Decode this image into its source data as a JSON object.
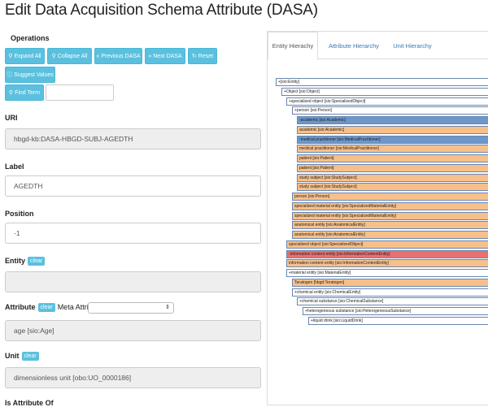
{
  "page": {
    "title": "Edit Data Acquisition Schema Attribute (DASA)"
  },
  "operations": {
    "label": "Operations",
    "buttons": {
      "expand_all": "Expand All",
      "collapse_all": "Collapse All",
      "previous_dasa": "Previous DASA",
      "next_dasa": "Next DASA",
      "reset": "Reset",
      "suggest_values": "Suggest Values",
      "find_term": "Find Term"
    },
    "find_term_value": ""
  },
  "fields": {
    "uri": {
      "label": "URI",
      "value": "hbgd-kb:DASA-HBGD-SUBJ-AGEDTH"
    },
    "label": {
      "label": "Label",
      "value": "AGEDTH"
    },
    "position": {
      "label": "Position",
      "value": "-1"
    },
    "entity": {
      "label": "Entity",
      "clear": "clear",
      "value": ""
    },
    "attribute": {
      "label": "Attribute",
      "clear": "clear",
      "meta_label": "Meta Attribute",
      "meta_value": "",
      "value": "age [sio:Age]"
    },
    "unit": {
      "label": "Unit",
      "clear": "clear",
      "value": "dimensionless unit [obo:UO_0000186]"
    },
    "is_attribute_of": {
      "label": "Is Attribute Of"
    }
  },
  "tabs": [
    "Entity Hierachy",
    "Attribute Hierarchy",
    "Unit Hierarchy"
  ],
  "tree": [
    {
      "label": "+[sio:Entity]",
      "color": "white"
    },
    {
      "label": "+Object [sio:Object]",
      "color": "white"
    },
    {
      "label": "+specialized object [sio:SpecializedObject]",
      "color": "white"
    },
    {
      "label": "+person [sio:Person]",
      "color": "white"
    },
    {
      "label": "-academic [sio:Academic]",
      "color": "blue"
    },
    {
      "label": "academic [sio:Academic]",
      "color": "orange"
    },
    {
      "label": "-medical practitioner [sio:MedicalPractitioner]",
      "color": "blue"
    },
    {
      "label": "medical practitioner [sio:MedicalPractitioner]",
      "color": "orange"
    },
    {
      "label": "patient [sio:Patient]",
      "color": "orange"
    },
    {
      "label": "patient [sio:Patient]",
      "color": "orange"
    },
    {
      "label": "study subject [sio:StudySubject]",
      "color": "orange"
    },
    {
      "label": "study subject [sio:StudySubject]",
      "color": "orange"
    },
    {
      "label": "person [sio:Person]",
      "color": "orange"
    },
    {
      "label": "specialized material entity [sio:SpecializedMaterialEntity]",
      "color": "orange"
    },
    {
      "label": "specialized material entity [sio:SpecializedMaterialEntity]",
      "color": "orange"
    },
    {
      "label": "anatomical entity [sio:AnatomicalEntity]",
      "color": "orange"
    },
    {
      "label": "anatomical entity [sio:AnatomicalEntity]",
      "color": "orange"
    },
    {
      "label": "specialized object [sio:SpecializedObject]",
      "color": "orange"
    },
    {
      "label": "-information content entity [sio:InformationContentEntity]",
      "color": "red"
    },
    {
      "label": "information content entity [sio:InformationContentEntity]",
      "color": "orange"
    },
    {
      "label": "+material entity [sio:MaterialEntity]",
      "color": "white"
    },
    {
      "label": "Teratogen [hbgd:Teratogen]",
      "color": "orange"
    },
    {
      "label": "+chemical entity [sio:ChemicalEntity]",
      "color": "white"
    },
    {
      "label": "+chemical substance [sio:ChemicalSubstance]",
      "color": "white"
    },
    {
      "label": "+heterogeneous substance [sio:HeterogeneousSubstance]",
      "color": "white"
    },
    {
      "label": "+liquid drink [sio:LiquidDrink]",
      "color": "white"
    }
  ],
  "colors": {
    "button": "#5bc0de",
    "tree_blue": "#6d97c9",
    "tree_orange": "#f7c08b",
    "tree_red": "#e87070",
    "link": "#337ab7"
  },
  "icons": [
    "search-icon",
    "backward-icon",
    "forward-icon",
    "refresh-icon",
    "info-icon",
    "chevron-updown-icon"
  ]
}
